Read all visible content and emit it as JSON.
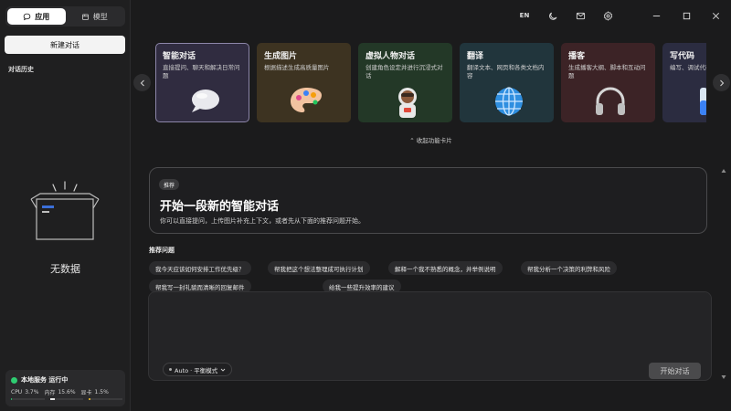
{
  "sidebar": {
    "tabs": [
      {
        "label": "应用",
        "icon": "chat-bubble-icon",
        "active": true
      },
      {
        "label": "模型",
        "icon": "cube-icon",
        "active": false
      }
    ],
    "new_chat_label": "新建对话",
    "history_title": "对话历史",
    "empty_text": "无数据",
    "status": {
      "label": "本地服务 运行中",
      "color": "#2ecc71",
      "metrics": [
        {
          "name": "CPU",
          "value": "3.7%",
          "fill": 0.037,
          "color": "#27ae60"
        },
        {
          "name": "内存",
          "value": "15.6%",
          "fill": 0.156,
          "color": "#e6e6e6"
        },
        {
          "name": "显卡",
          "value": "1.5%",
          "fill": 0.015,
          "color": "#c9a227"
        }
      ]
    }
  },
  "titlebar": {
    "lang": "EN",
    "icons": [
      "moon-icon",
      "mail-icon",
      "gear-icon",
      "minimize-icon",
      "maximize-icon",
      "close-icon"
    ]
  },
  "cards": [
    {
      "title": "智能对话",
      "desc": "直接提问、聊天和解决日常问题",
      "bg": "#302c40",
      "border": "#8c86a8",
      "icon": "speech-bubble-icon"
    },
    {
      "title": "生成图片",
      "desc": "根据描述生成高质量图片",
      "bg": "#3d3321",
      "border": "#3d3321",
      "icon": "palette-icon"
    },
    {
      "title": "虚拟人物对话",
      "desc": "创建角色设定并进行沉浸式对话",
      "bg": "#233827",
      "border": "#233827",
      "icon": "astronaut-icon"
    },
    {
      "title": "翻译",
      "desc": "翻译文本、网页和各类文档内容",
      "bg": "#21353c",
      "border": "#21353c",
      "icon": "globe-icon"
    },
    {
      "title": "播客",
      "desc": "生成播客大纲、脚本和互动问题",
      "bg": "#3c2326",
      "border": "#3c2326",
      "icon": "headphones-icon"
    },
    {
      "title": "写代码",
      "desc": "编写、调试代码片段",
      "bg": "#2b2c40",
      "border": "#2b2c40",
      "icon": "test-tube-icon"
    }
  ],
  "collapse_label": "收起功能卡片",
  "hero": {
    "tag": "推荐",
    "title": "开始一段新的智能对话",
    "subtitle": "你可以直接提问，上传图片补充上下文，或者先从下面的推荐问题开始。"
  },
  "suggestions": {
    "title": "推荐问题",
    "items": [
      "我今天应该如何安排工作优先级？",
      "帮我把这个想法整理成可执行计划",
      "解释一个我不熟悉的概念，并举例说明",
      "帮我分析一个决策的利弊和风险",
      "帮我写一封礼貌而清晰的回复邮件",
      "给我一些提升效率的建议"
    ]
  },
  "composer": {
    "model_label": "Auto · 平衡模式",
    "start_label": "开始对话"
  }
}
